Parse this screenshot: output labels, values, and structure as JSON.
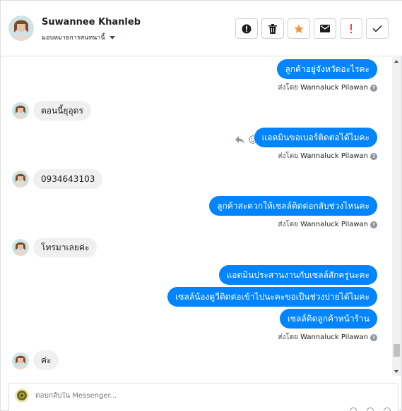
{
  "header": {
    "name": "Suwannee Khanleb",
    "assignee": "มอบหมายการสนทนานี้",
    "actions": [
      {
        "icon": "alert-circle-icon",
        "name": "mark-spam-button"
      },
      {
        "icon": "trash-icon",
        "name": "delete-button"
      },
      {
        "icon": "star-icon",
        "name": "star-button"
      },
      {
        "icon": "mail-icon",
        "name": "mark-unread-button"
      },
      {
        "icon": "exclamation-icon",
        "name": "follow-up-button"
      },
      {
        "icon": "check-icon",
        "name": "mark-done-button"
      }
    ]
  },
  "messages": [
    {
      "dir": "out",
      "text": "ลูกค้าอยู่จังหวัดอะไรคะ"
    },
    {
      "type": "sent_by",
      "prefix": "ส่งโดย",
      "who": "Wannaluck Pilawan"
    },
    {
      "dir": "in",
      "text": "ตอนนี้ยุอุดร"
    },
    {
      "dir": "out",
      "text": "แอดมินขอเบอร์ติดต่อได้ไมคะ"
    },
    {
      "type": "sent_by",
      "prefix": "ส่งโดย",
      "who": "Wannaluck Pilawan"
    },
    {
      "dir": "in",
      "text": "0934643103"
    },
    {
      "dir": "out",
      "text": "ลูกค้าสะดวกให้เซลล์ติดต่อกลับช่วงไหนคะ"
    },
    {
      "type": "sent_by",
      "prefix": "ส่งโดย",
      "who": "Wannaluck Pilawan"
    },
    {
      "dir": "in",
      "text": "โทรมาเลยค่ะ"
    },
    {
      "dir": "out",
      "text": "แอดมินประสานงานกับเซลล์สักครู่นะคะ"
    },
    {
      "dir": "out",
      "text": "เซลล์น้องดูวีติดต่อเข้าไปนะคะขอเป็นช่วงบ่ายได้ไมคะ"
    },
    {
      "dir": "out",
      "text": "เซลล์ติดลูกค้าหน้าร้าน"
    },
    {
      "type": "sent_by",
      "prefix": "ส่งโดย",
      "who": "Wannaluck Pilawan"
    },
    {
      "dir": "in",
      "text": "ค่ะ"
    }
  ],
  "composer": {
    "placeholder": "ตอบกลับใน Messenger..."
  },
  "colors": {
    "outgoing_bubble": "#0084ff",
    "incoming_bubble": "#f1f0f0",
    "star": "#f7923b",
    "follow_up": "#fa3e3e"
  }
}
